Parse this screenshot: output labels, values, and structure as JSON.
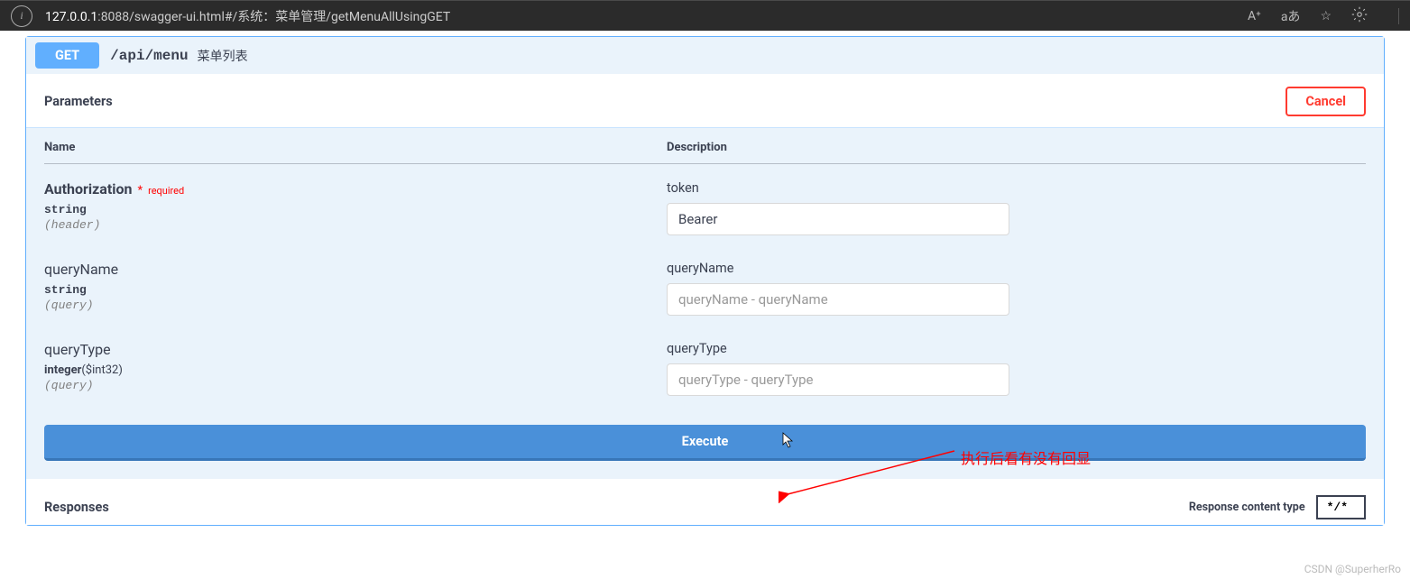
{
  "browser": {
    "url_host": "127.0.0.1",
    "url_rest": ":8088/swagger-ui.html#/系统：菜单管理/getMenuAllUsingGET",
    "reading_icon": "A⁺",
    "translate_icon": "aあ"
  },
  "endpoint": {
    "method": "GET",
    "path": "/api/menu",
    "description": "菜单列表"
  },
  "parameters": {
    "section_title": "Parameters",
    "cancel_label": "Cancel",
    "name_header": "Name",
    "desc_header": "Description",
    "required_text": "required",
    "items": [
      {
        "name": "Authorization",
        "required": true,
        "type": "string",
        "type_extra": "",
        "in": "(header)",
        "desc": "token",
        "value": "Bearer",
        "placeholder": ""
      },
      {
        "name": "queryName",
        "required": false,
        "type": "string",
        "type_extra": "",
        "in": "(query)",
        "desc": "queryName",
        "value": "",
        "placeholder": "queryName - queryName"
      },
      {
        "name": "queryType",
        "required": false,
        "type": "integer",
        "type_extra": "($int32)",
        "in": "(query)",
        "desc": "queryType",
        "value": "",
        "placeholder": "queryType - queryType"
      }
    ]
  },
  "execute_label": "Execute",
  "annotation_text": "执行后看有没有回显",
  "responses": {
    "section_title": "Responses",
    "content_type_label": "Response content type",
    "content_type_value": "*/*"
  },
  "watermark": "CSDN @SuperherRo"
}
